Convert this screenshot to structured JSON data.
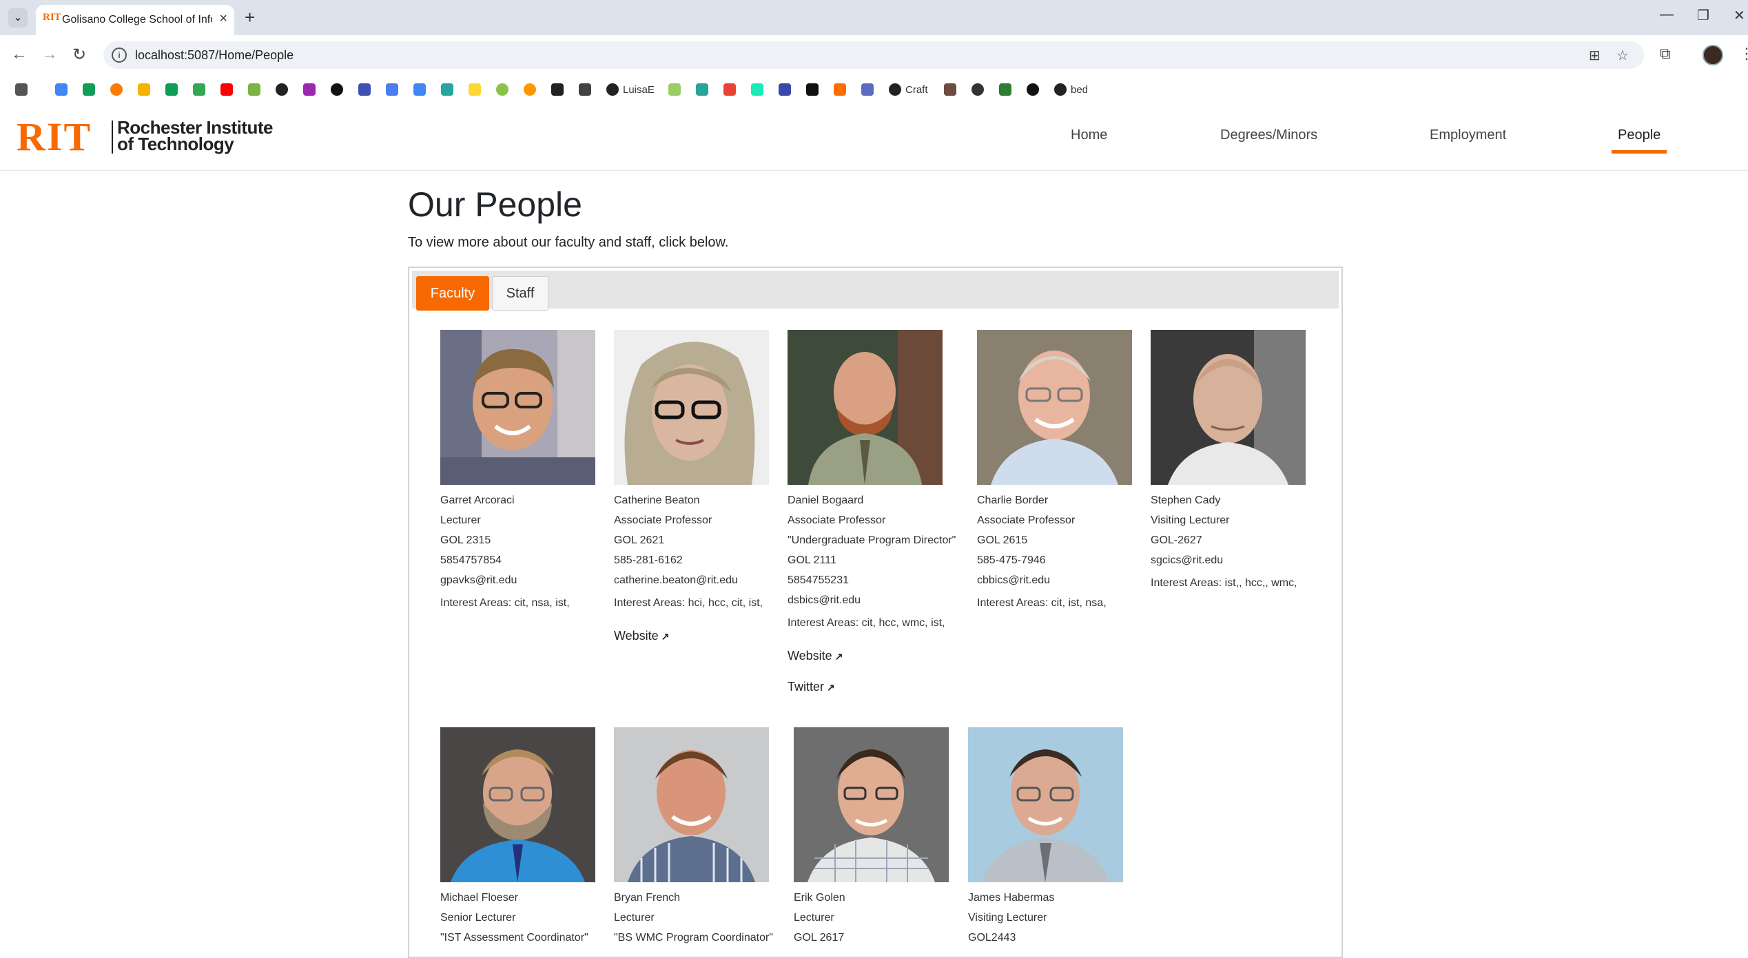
{
  "browser": {
    "tab_favicon": "RIT",
    "tab_title": "Golisano College School of Info",
    "url": "localhost:5087/Home/People",
    "bookmarks": [
      "LuisaE",
      "Craft",
      "bed"
    ]
  },
  "site": {
    "logo_rit": "RIT",
    "logo_line1": "Rochester Institute",
    "logo_line2": "of Technology",
    "nav": [
      {
        "label": "Home"
      },
      {
        "label": "Degrees/Minors"
      },
      {
        "label": "Employment"
      },
      {
        "label": "People"
      }
    ],
    "active_nav": "People",
    "accent_color": "#f76902"
  },
  "page": {
    "title": "Our People",
    "intro": "To view more about our faculty and staff, click below.",
    "tabs": [
      {
        "label": "Faculty"
      },
      {
        "label": "Staff"
      }
    ],
    "active_tab": "Faculty"
  },
  "faculty": [
    {
      "name": "Garret Arcoraci",
      "title": "Lecturer",
      "office": "GOL 2315",
      "phone": "5854757854",
      "email": "gpavks@rit.edu",
      "interests": "Interest Areas: cit, nsa, ist,"
    },
    {
      "name": "Catherine Beaton",
      "title": "Associate Professor",
      "office": "GOL 2621",
      "phone": "585-281-6162",
      "email": "catherine.beaton@rit.edu",
      "interests": "Interest Areas: hci, hcc, cit, ist,",
      "website": "Website"
    },
    {
      "name": "Daniel Bogaard",
      "title": "Associate Professor",
      "tagline": "\"Undergraduate Program Director\"",
      "office": "GOL 2111",
      "phone": "5854755231",
      "email": "dsbics@rit.edu",
      "interests": "Interest Areas: cit, hcc, wmc, ist,",
      "website": "Website",
      "twitter": "Twitter"
    },
    {
      "name": "Charlie Border",
      "title": "Associate Professor",
      "office": "GOL 2615",
      "phone": "585-475-7946",
      "email": "cbbics@rit.edu",
      "interests": "Interest Areas: cit, ist, nsa,"
    },
    {
      "name": "Stephen Cady",
      "title": "Visiting Lecturer",
      "office": "GOL-2627",
      "email": "sgcics@rit.edu",
      "interests": "Interest Areas: ist,, hcc,, wmc,"
    },
    {
      "name": "Michael Floeser",
      "title": "Senior Lecturer",
      "tagline": "\"IST Assessment Coordinator\""
    },
    {
      "name": "Bryan French",
      "title": "Lecturer",
      "tagline": "\"BS WMC Program Coordinator\""
    },
    {
      "name": "Erik Golen",
      "title": "Lecturer",
      "office": "GOL 2617"
    },
    {
      "name": "James Habermas",
      "title": "Visiting Lecturer",
      "office": "GOL2443"
    }
  ]
}
